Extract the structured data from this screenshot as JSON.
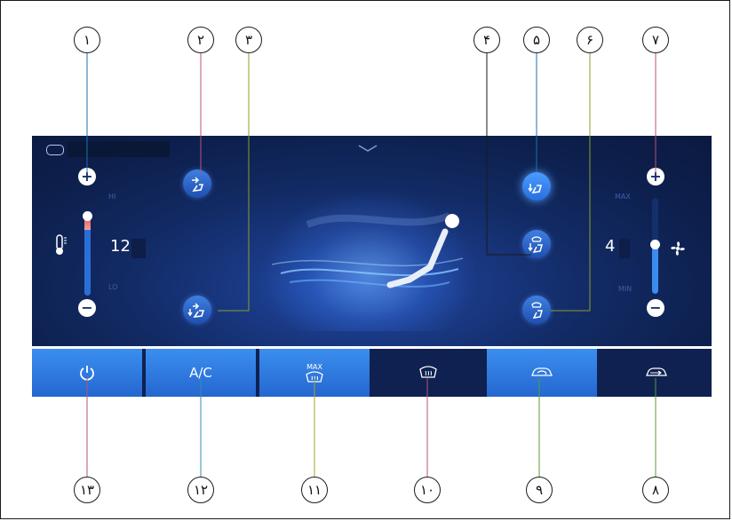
{
  "callouts": {
    "c1": "١",
    "c2": "٢",
    "c3": "٣",
    "c4": "۴",
    "c5": "۵",
    "c6": "۶",
    "c7": "٧",
    "c8": "٨",
    "c9": "٩",
    "c10": "١٠",
    "c11": "١١",
    "c12": "١٢",
    "c13": "١٣"
  },
  "panel": {
    "temp_max_label": "HI",
    "temp_min_label": "LO",
    "temperature": "12",
    "temp_level": 0.08,
    "fan_max_label": "MAX",
    "fan_min_label": "MIN",
    "fan_speed": "4",
    "fan_level": 0.55,
    "plus": "+",
    "minus": "−"
  },
  "bottom_bar": {
    "ac_label": "A/C",
    "max_defrost_label": "MAX"
  },
  "colors": {
    "active_tile": "#2f7be6",
    "screen_bg": "#0d1f4c",
    "temp_hot": "#e84545",
    "slider": "#3a8cf0"
  }
}
